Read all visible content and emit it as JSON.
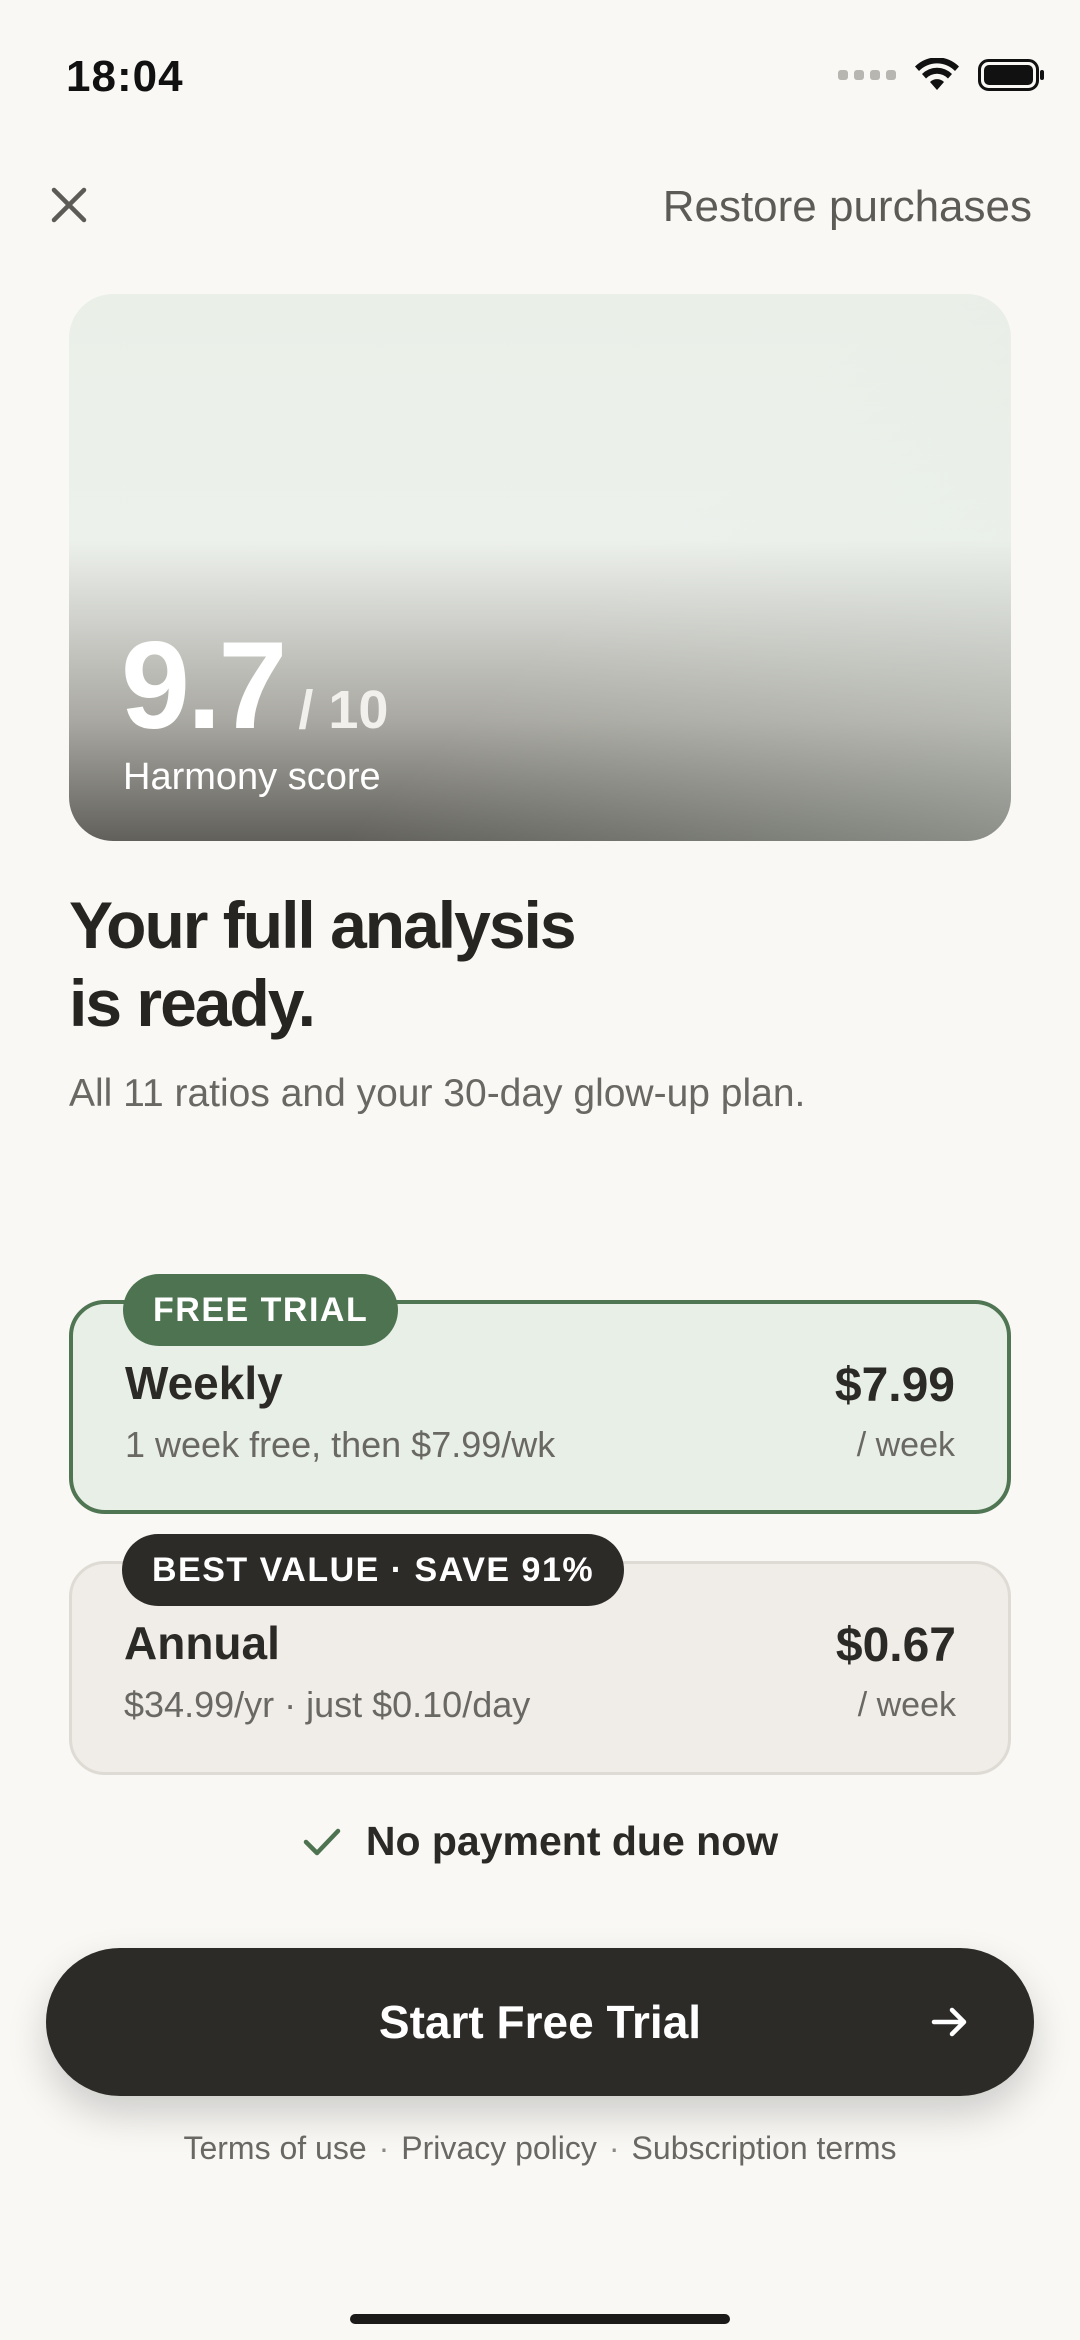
{
  "status_bar": {
    "time": "18:04",
    "icons": [
      "signal-icon",
      "wifi-icon",
      "battery-icon"
    ]
  },
  "nav": {
    "close_icon": "close-icon",
    "restore_label": "Restore purchases"
  },
  "hero": {
    "score": "9.7",
    "score_max": "/ 10",
    "score_label": "Harmony score"
  },
  "headline": {
    "line1": "Your full analysis",
    "line2": "is ready.",
    "subtitle": "All 11 ratios and your 30-day glow-up plan."
  },
  "plans": [
    {
      "badge": "FREE TRIAL",
      "name": "Weekly",
      "detail": "1 week free, then $7.99/wk",
      "price": "$7.99",
      "period": "/ week",
      "selected": true
    },
    {
      "badge": "BEST VALUE · SAVE 91%",
      "name": "Annual",
      "detail": "$34.99/yr · just $0.10/day",
      "price": "$0.67",
      "period": "/ week",
      "selected": false
    }
  ],
  "no_payment": "No payment due now",
  "cta": {
    "label": "Start Free Trial",
    "icon": "arrow-right-icon"
  },
  "footer": {
    "terms": "Terms of use",
    "privacy": "Privacy policy",
    "subscription": "Subscription terms",
    "separator": "·"
  },
  "colors": {
    "accent_green": "#4d7351",
    "dark": "#2d2b28",
    "background": "#f9f8f5"
  }
}
